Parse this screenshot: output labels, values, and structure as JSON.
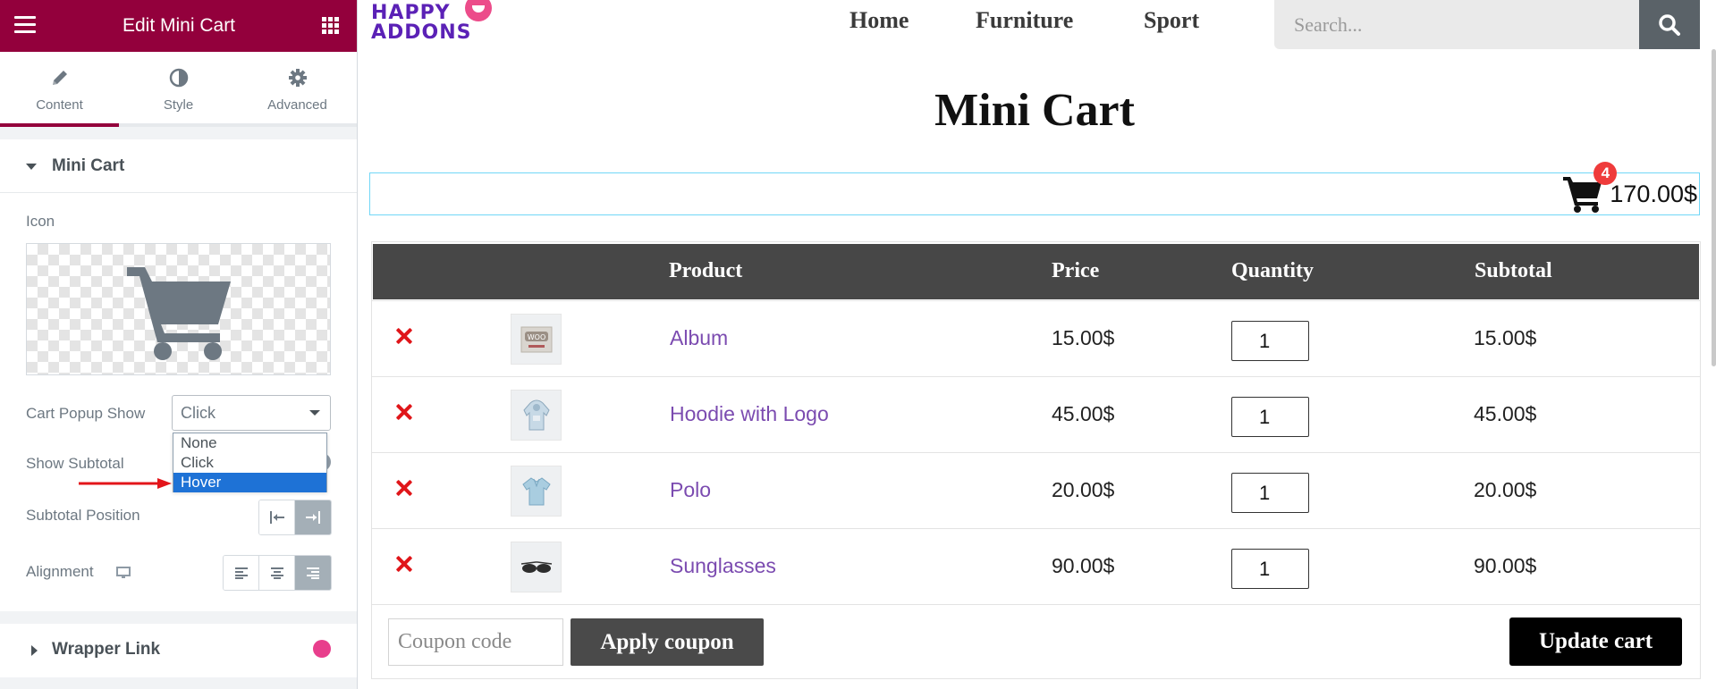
{
  "panel": {
    "title": "Edit Mini Cart",
    "tabs": [
      {
        "label": "Content",
        "icon": "pencil-icon"
      },
      {
        "label": "Style",
        "icon": "half-circle-icon"
      },
      {
        "label": "Advanced",
        "icon": "gear-icon"
      }
    ],
    "active_tab": "Content",
    "section_title": "Mini Cart",
    "icon_label": "Icon",
    "icon_preview": "cart-icon",
    "cart_popup_show": {
      "label": "Cart Popup Show",
      "value": "Click",
      "options": [
        "None",
        "Click",
        "Hover"
      ],
      "highlighted": "Hover"
    },
    "show_subtotal_label": "Show Subtotal",
    "subtotal_position_label": "Subtotal Position",
    "alignment_label": "Alignment",
    "wrapper_link_title": "Wrapper Link",
    "accent_color": "#93003c"
  },
  "site": {
    "logo": {
      "line1": "HAPPY",
      "line2": "ADDONS"
    },
    "nav": [
      "Home",
      "Furniture",
      "Sport"
    ],
    "search_placeholder": "Search...",
    "page_title": "Mini Cart",
    "mini_cart": {
      "count": "4",
      "total": "170.00$"
    },
    "table": {
      "headers": {
        "product": "Product",
        "price": "Price",
        "quantity": "Quantity",
        "subtotal": "Subtotal"
      },
      "rows": [
        {
          "name": "Album",
          "price": "15.00$",
          "qty": "1",
          "subtotal": "15.00$",
          "thumb": "woo-album-icon"
        },
        {
          "name": "Hoodie with Logo",
          "price": "45.00$",
          "qty": "1",
          "subtotal": "45.00$",
          "thumb": "hoodie-icon"
        },
        {
          "name": "Polo",
          "price": "20.00$",
          "qty": "1",
          "subtotal": "20.00$",
          "thumb": "polo-shirt-icon"
        },
        {
          "name": "Sunglasses",
          "price": "90.00$",
          "qty": "1",
          "subtotal": "90.00$",
          "thumb": "sunglasses-icon"
        }
      ]
    },
    "coupon_placeholder": "Coupon code",
    "apply_coupon_label": "Apply coupon",
    "update_cart_label": "Update cart"
  }
}
